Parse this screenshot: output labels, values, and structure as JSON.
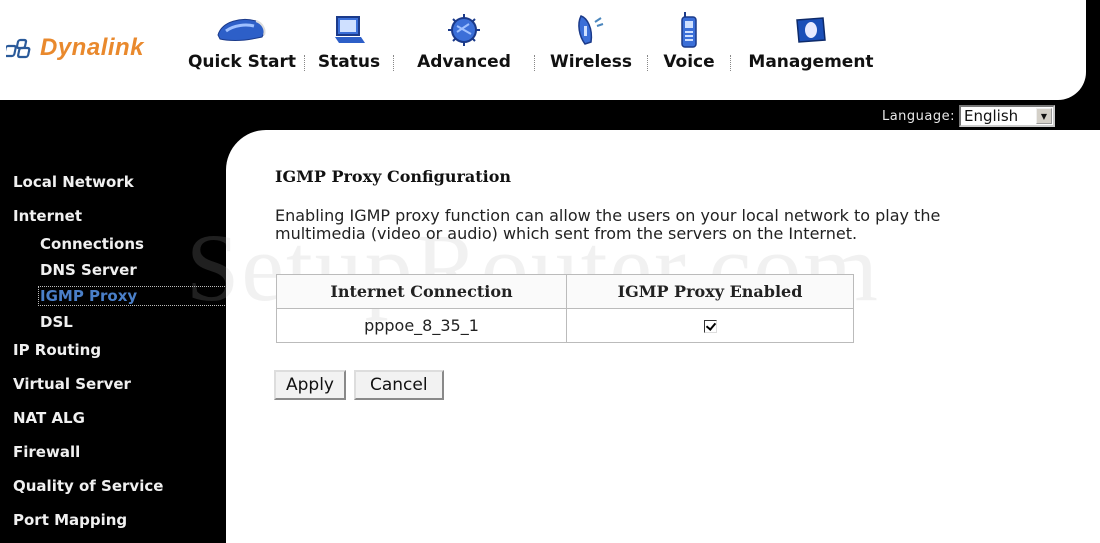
{
  "brand": {
    "name": "Dynalink",
    "color": "#e9892d"
  },
  "nav": {
    "items": [
      {
        "label": "Quick Start",
        "icon": "quick-start-icon",
        "active": false
      },
      {
        "label": "Status",
        "icon": "status-monitor-icon",
        "active": false
      },
      {
        "label": "Advanced",
        "icon": "advanced-chip-icon",
        "active": true
      },
      {
        "label": "Wireless",
        "icon": "wireless-antenna-icon",
        "active": false
      },
      {
        "label": "Voice",
        "icon": "voice-phone-icon",
        "active": false
      },
      {
        "label": "Management",
        "icon": "management-icon",
        "active": false
      }
    ],
    "active_color": "#4a86bd"
  },
  "language": {
    "label": "Language:",
    "selected": "English"
  },
  "sidebar": {
    "items": [
      {
        "label": "Local Network"
      },
      {
        "label": "Internet"
      },
      {
        "label": "Connections"
      },
      {
        "label": "DNS Server"
      },
      {
        "label": "IGMP Proxy"
      },
      {
        "label": "DSL"
      },
      {
        "label": "IP Routing"
      },
      {
        "label": "Virtual Server"
      },
      {
        "label": "NAT ALG"
      },
      {
        "label": "Firewall"
      },
      {
        "label": "Quality of Service"
      },
      {
        "label": "Port Mapping"
      }
    ]
  },
  "main": {
    "title": "IGMP Proxy Configuration",
    "description": "Enabling IGMP proxy function can allow the users on your local network to play the multimedia (video or audio) which sent from the servers on the Internet.",
    "table": {
      "headers": [
        "Internet Connection",
        "IGMP Proxy Enabled"
      ],
      "rows": [
        {
          "connection": "pppoe_8_35_1",
          "enabled": true
        }
      ]
    },
    "apply_label": "Apply",
    "cancel_label": "Cancel"
  },
  "watermark": "SetupRouter.com"
}
